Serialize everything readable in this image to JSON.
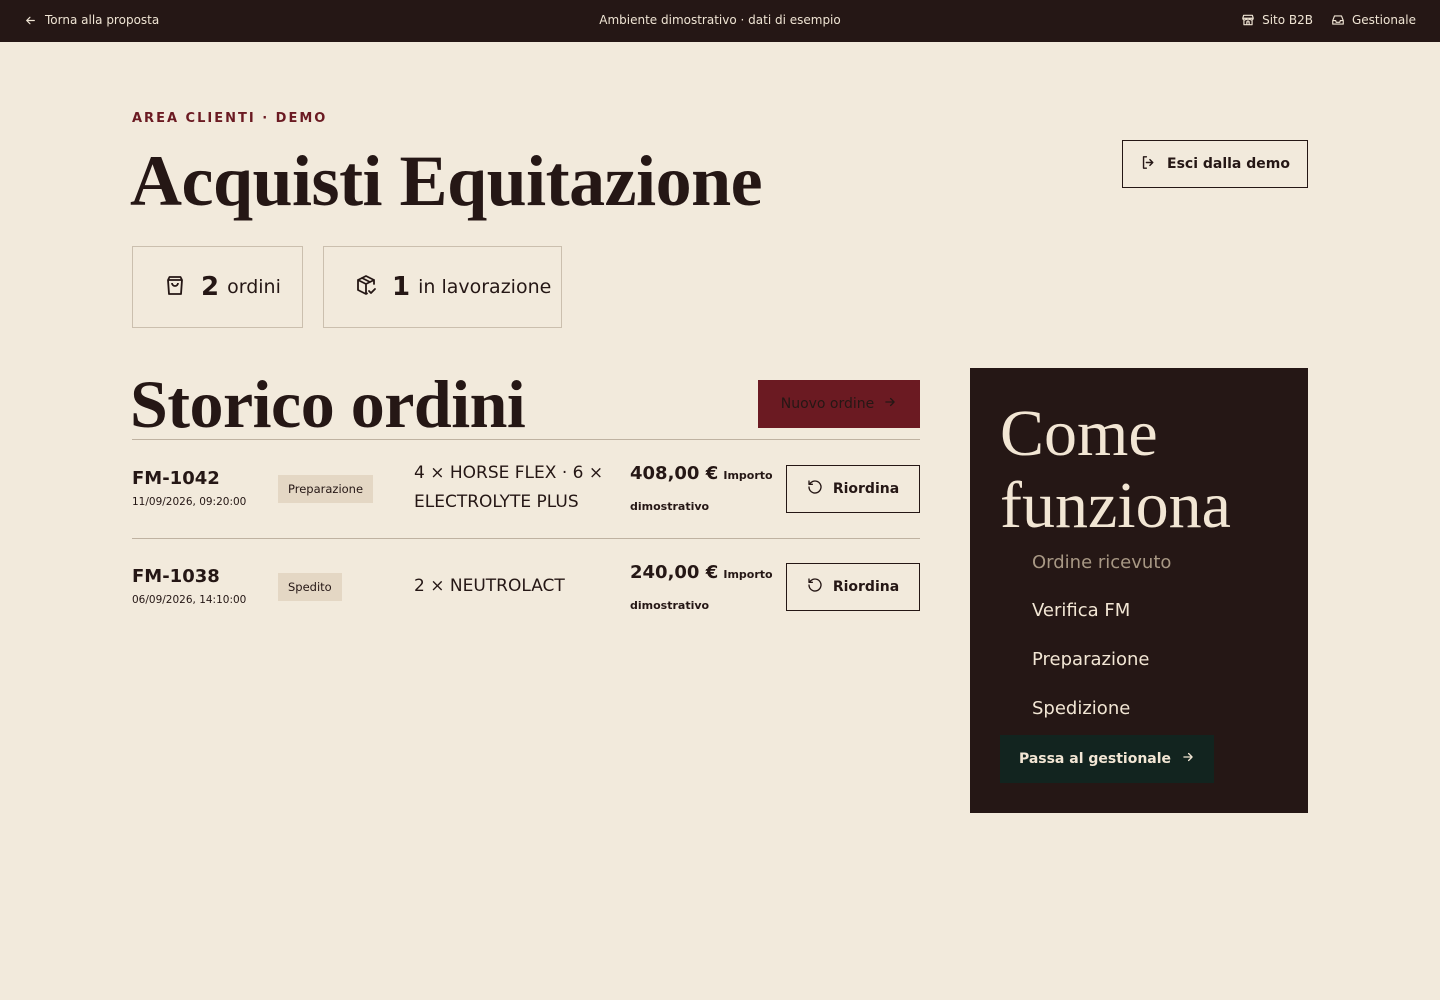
{
  "topbar": {
    "back_label": "Torna alla proposta",
    "center_label": "Ambiente dimostrativo · dati di esempio",
    "site_label": "Sito B2B",
    "mgmt_label": "Gestionale"
  },
  "header": {
    "eyebrow": "AREA CLIENTI · DEMO",
    "title": "Acquisti Equitazione",
    "exit_label": "Esci dalla demo"
  },
  "stats": [
    {
      "value": "2",
      "label": "ordini",
      "icon": "shopping-bag-icon"
    },
    {
      "value": "1",
      "label": "in lavorazione",
      "icon": "package-check-icon"
    }
  ],
  "orders": {
    "title": "Storico ordini",
    "new_label": "Nuovo ordine",
    "rows": [
      {
        "code": "FM-1042",
        "date": "11/09/2026, 09:20:00",
        "status": "Preparazione",
        "items": "4 × HORSE FLEX · 6 × ELECTROLYTE PLUS",
        "amount": "408,00 €",
        "amount_note": "Importo dimostrativo",
        "action": "Riordina"
      },
      {
        "code": "FM-1038",
        "date": "06/09/2026, 14:10:00",
        "status": "Spedito",
        "items": "2 × NEUTROLACT",
        "amount": "240,00 €",
        "amount_note": "Importo dimostrativo",
        "action": "Riordina"
      }
    ]
  },
  "panel": {
    "title": "Come funziona",
    "steps": [
      "Ordine ricevuto",
      "Verifica FM",
      "Preparazione",
      "Spedizione"
    ],
    "cta_label": "Passa al gestionale"
  },
  "colors": {
    "background": "#f2eadc",
    "dark": "#251715",
    "accent": "#6b1a22",
    "cta_dark": "#12241f"
  }
}
